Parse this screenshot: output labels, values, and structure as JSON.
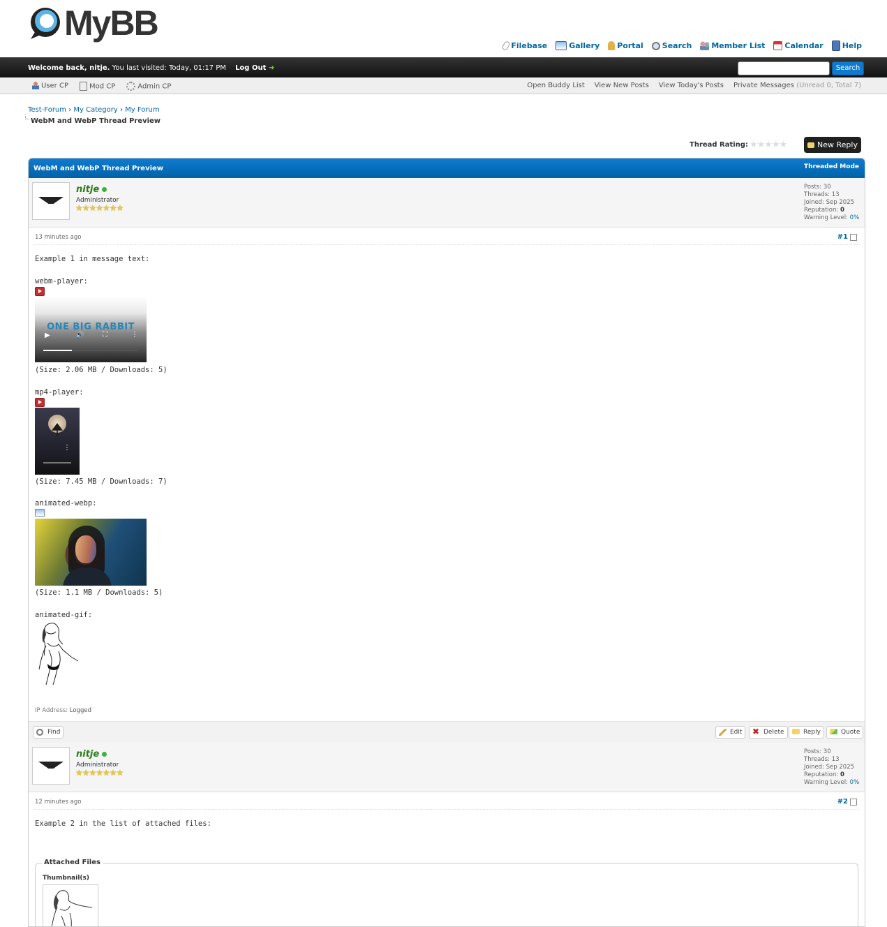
{
  "header": {
    "logo_text": "MyBB",
    "top_links": [
      "Filebase",
      "Gallery",
      "Portal",
      "Search",
      "Member List",
      "Calendar",
      "Help"
    ]
  },
  "welcome": {
    "greeting": "Welcome back, nitje.",
    "last_visit": "You last visited: Today, 01:17 PM",
    "logout": "Log Out",
    "search_button": "Search",
    "search_placeholder": ""
  },
  "panel": {
    "left": [
      "User CP",
      "Mod CP",
      "Admin CP"
    ],
    "right": [
      "Open Buddy List",
      "View New Posts",
      "View Today's Posts"
    ],
    "pm_label": "Private Messages",
    "pm_counts": "(Unread 0, Total 7)"
  },
  "breadcrumb": {
    "items": [
      "Test-Forum",
      "My Category",
      "My Forum"
    ],
    "separator": "›",
    "current": "WebM and WebP Thread Preview"
  },
  "thread": {
    "rating_label": "Thread Rating:",
    "new_reply": "New Reply",
    "title": "WebM and WebP Thread Preview",
    "mode": "Threaded Mode"
  },
  "posts": [
    {
      "author": "nitje",
      "user_title": "Administrator",
      "stars": 7,
      "stats": {
        "posts_label": "Posts:",
        "posts": "30",
        "threads_label": "Threads:",
        "threads": "13",
        "joined_label": "Joined:",
        "joined": "Sep 2025",
        "rep_label": "Reputation:",
        "rep": "0",
        "warn_label": "Warning Level:",
        "warn": "0%"
      },
      "date": "13 minutes ago",
      "number": "#1",
      "intro": "Example 1 in message text:",
      "webm_label": "webm-player:",
      "webm_brand": "ONE BIG RABBIT",
      "webm_size": "(Size: 2.06 MB / Downloads: 5)",
      "webm_progress": 0.3,
      "mp4_label": "mp4-player:",
      "mp4_size": "(Size: 7.45 MB / Downloads: 7)",
      "webp_label": "animated-webp:",
      "webp_size": "(Size: 1.1 MB / Downloads: 5)",
      "gif_label": "animated-gif:",
      "ip_label": "IP Address:",
      "ip_value": "Logged",
      "find": "Find",
      "edit": "Edit",
      "delete": "Delete",
      "reply": "Reply",
      "quote": "Quote"
    },
    {
      "author": "nitje",
      "user_title": "Administrator",
      "stars": 7,
      "stats": {
        "posts_label": "Posts:",
        "posts": "30",
        "threads_label": "Threads:",
        "threads": "13",
        "joined_label": "Joined:",
        "joined": "Sep 2025",
        "rep_label": "Reputation:",
        "rep": "0",
        "warn_label": "Warning Level:",
        "warn": "0%"
      },
      "date": "12 minutes ago",
      "number": "#2",
      "intro": "Example 2 in the list of attached files:",
      "attached_legend": "Attached Files",
      "thumbnails_label": "Thumbnail(s)"
    }
  ],
  "colors": {
    "accent": "#0066a2",
    "thead": "#0f7bd0",
    "online": "#3cb13c",
    "username": "#2c7d1a"
  }
}
